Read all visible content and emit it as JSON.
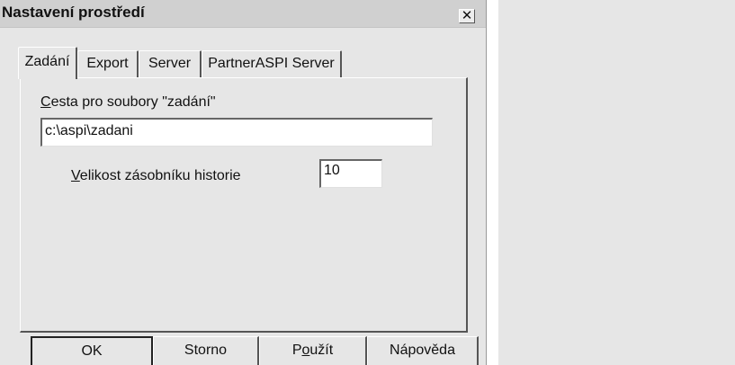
{
  "dialog": {
    "title": "Nastavení prostředí",
    "close_glyph": "✕"
  },
  "tabs": [
    {
      "label": "Zadání",
      "active": true
    },
    {
      "label": "Export",
      "active": false
    },
    {
      "label": "Server",
      "active": false
    },
    {
      "label": "PartnerASPI Server",
      "active": false
    }
  ],
  "zadani": {
    "path_label_mnemonic": "C",
    "path_label_rest": "esta pro soubory \"zadání\"",
    "path_value": "c:\\aspi\\zadani",
    "history_label_mnemonic": "V",
    "history_label_rest": "elikost zásobníku historie",
    "history_value": "10"
  },
  "buttons": {
    "ok": "OK",
    "cancel": "Storno",
    "apply_pre": "P",
    "apply_mnemonic": "o",
    "apply_post": "užít",
    "help": "Nápověda"
  },
  "icons": [
    "close-icon"
  ]
}
